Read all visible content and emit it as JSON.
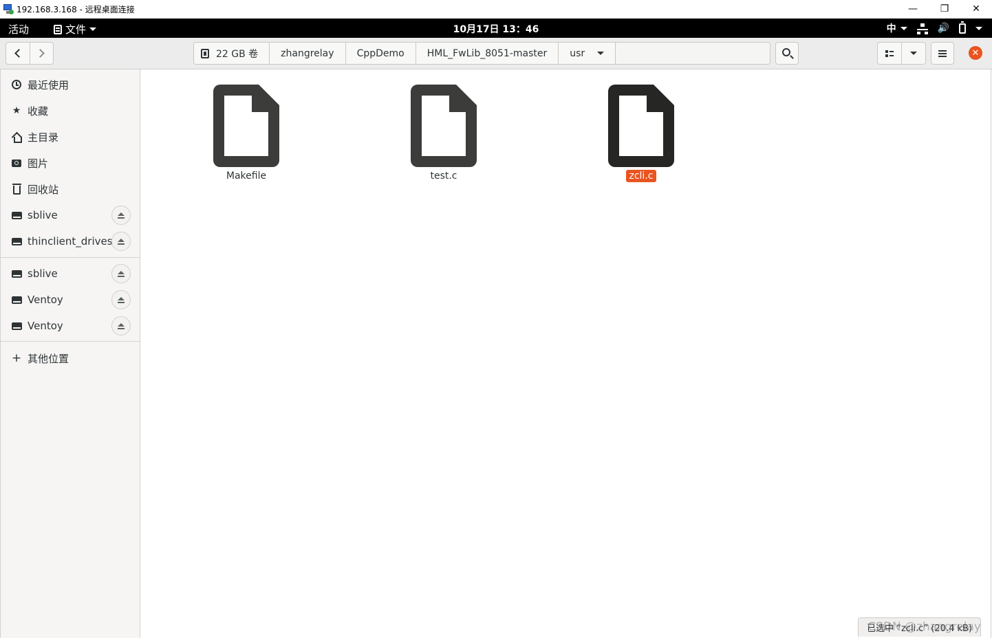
{
  "rdp": {
    "title": "192.168.3.168 - 远程桌面连接",
    "minimize": "—",
    "restore": "❐",
    "close": "✕"
  },
  "topbar": {
    "activities": "活动",
    "app_menu": "文件",
    "clock": "10月17日 13：46",
    "ime": "中",
    "volume_icon": "🔊"
  },
  "pathbar": {
    "crumbs": [
      "22 GB 卷",
      "zhangrelay",
      "CppDemo",
      "HML_FwLib_8051-master",
      "usr"
    ]
  },
  "sidebar": {
    "items": [
      {
        "label": "最近使用",
        "icon": "clock-icon"
      },
      {
        "label": "收藏",
        "icon": "star-icon"
      },
      {
        "label": "主目录",
        "icon": "home-icon"
      },
      {
        "label": "图片",
        "icon": "camera-icon"
      },
      {
        "label": "回收站",
        "icon": "trash-icon"
      },
      {
        "label": "sblive",
        "icon": "drive-icon",
        "eject": true
      },
      {
        "label": "thinclient_drives",
        "icon": "drive-icon",
        "eject": true
      },
      {
        "label": "sblive",
        "icon": "drive-icon",
        "eject": true
      },
      {
        "label": "Ventoy",
        "icon": "drive-icon",
        "eject": true
      },
      {
        "label": "Ventoy",
        "icon": "drive-icon",
        "eject": true
      },
      {
        "label": "其他位置",
        "icon": "plus-icon"
      }
    ]
  },
  "files": [
    {
      "name": "Makefile",
      "selected": false
    },
    {
      "name": "test.c",
      "selected": false
    },
    {
      "name": "zcli.c",
      "selected": true
    }
  ],
  "status": {
    "text": "已选中 “zcli.c” (20.4 kB)"
  },
  "watermark": "CSDN @zhangrelay",
  "colors": {
    "accent": "#e95420",
    "topbar": "#000000",
    "sidebar_bg": "#f6f5f4",
    "doc_icon": "#3c3c3a"
  }
}
